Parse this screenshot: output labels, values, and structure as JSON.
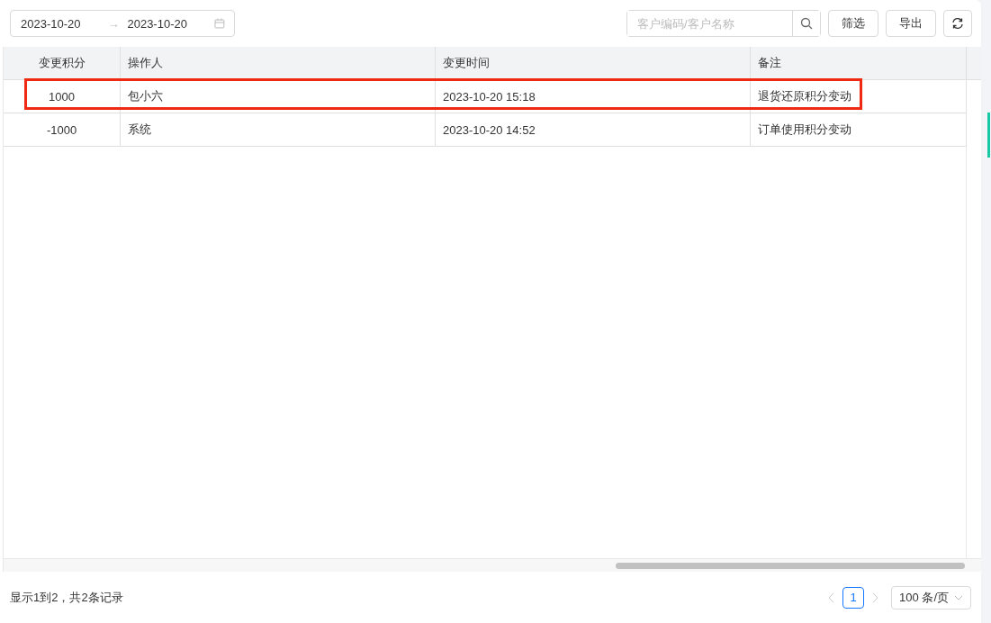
{
  "toolbar": {
    "date_range": {
      "start": "2023-10-20",
      "separator": "→",
      "end": "2023-10-20"
    },
    "search": {
      "placeholder": "客户编码/客户名称"
    },
    "buttons": [
      "筛选",
      "导出"
    ]
  },
  "table": {
    "columns": [
      "变更积分",
      "操作人",
      "变更时间",
      "备注"
    ],
    "rows": [
      {
        "cells": [
          "1000",
          "包小六",
          "2023-10-20 15:18",
          "退货还原积分变动"
        ],
        "highlighted": true
      },
      {
        "cells": [
          "-1000",
          "系统",
          "2023-10-20 14:52",
          "订单使用积分变动"
        ],
        "highlighted": false
      }
    ]
  },
  "footer": {
    "summary": "显示1到2，共2条记录",
    "pages": [
      {
        "label": "1",
        "selected": true
      }
    ],
    "page_size": "100 条/页"
  }
}
